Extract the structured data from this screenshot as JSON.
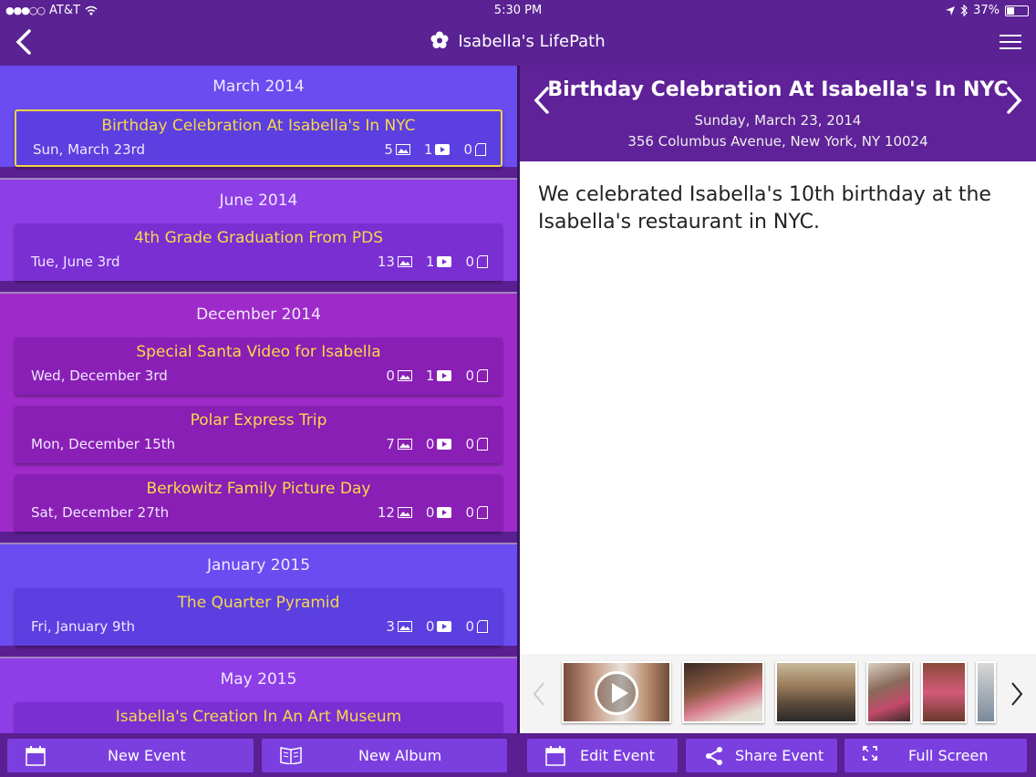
{
  "status": {
    "carrier": "AT&T",
    "time": "5:30 PM",
    "battery": "37%",
    "battery_level": 0.37
  },
  "nav": {
    "title": "Isabella's LifePath"
  },
  "months": [
    {
      "label": "March 2014",
      "events": [
        {
          "title": "Birthday Celebration At Isabella's In NYC",
          "date": "Sun, March 23rd",
          "photos": "5",
          "videos": "1",
          "docs": "0"
        }
      ]
    },
    {
      "label": "June 2014",
      "events": [
        {
          "title": "4th Grade Graduation From PDS",
          "date": "Tue, June 3rd",
          "photos": "13",
          "videos": "1",
          "docs": "0"
        }
      ]
    },
    {
      "label": "December 2014",
      "events": [
        {
          "title": "Special Santa Video for Isabella",
          "date": "Wed, December 3rd",
          "photos": "0",
          "videos": "1",
          "docs": "0"
        },
        {
          "title": "Polar Express Trip",
          "date": "Mon, December 15th",
          "photos": "7",
          "videos": "0",
          "docs": "0"
        },
        {
          "title": "Berkowitz Family Picture Day",
          "date": "Sat, December 27th",
          "photos": "12",
          "videos": "0",
          "docs": "0"
        }
      ]
    },
    {
      "label": "January 2015",
      "events": [
        {
          "title": "The Quarter Pyramid",
          "date": "Fri, January 9th",
          "photos": "3",
          "videos": "0",
          "docs": "0"
        }
      ]
    },
    {
      "label": "May 2015",
      "events": [
        {
          "title": "Isabella's Creation In An Art Museum",
          "date": "",
          "photos": "",
          "videos": "",
          "docs": ""
        }
      ]
    }
  ],
  "detail": {
    "title": "Birthday Celebration At Isabella's In NYC",
    "date": "Sunday, March 23, 2014",
    "address": "356 Columbus Avenue, New York, NY 10024",
    "description": "We celebrated Isabella's 10th birthday at the Isabella's restaurant in NYC."
  },
  "toolbar": {
    "new_event": "New Event",
    "new_album": "New Album",
    "edit_event": "Edit Event",
    "share_event": "Share Event",
    "full_screen": "Full Screen"
  },
  "colors": {
    "accent": "#f8d84a",
    "header": "#5f2298",
    "button": "#7b3fe0"
  }
}
